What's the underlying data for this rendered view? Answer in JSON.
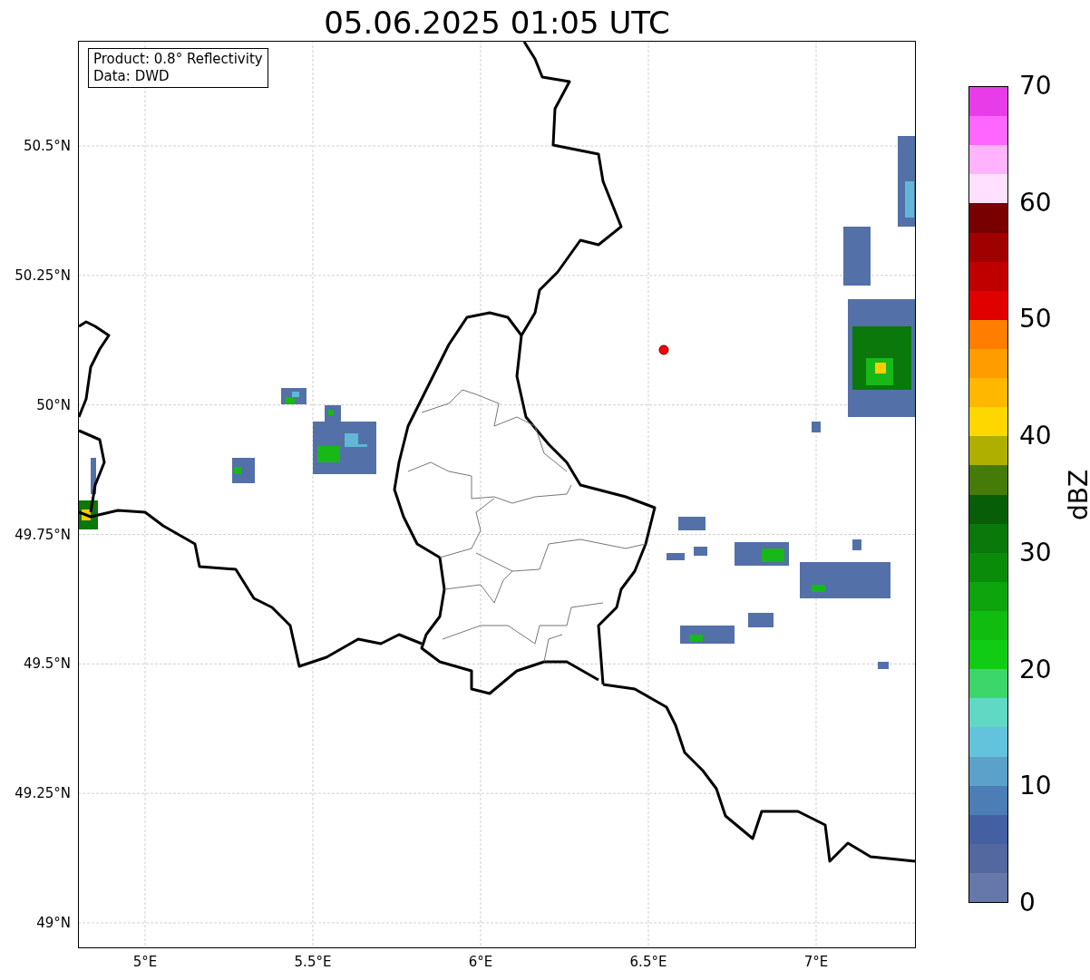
{
  "title": "05.06.2025 01:05 UTC",
  "legend": [
    "Product: 0.8° Reflectivity",
    "Data: DWD"
  ],
  "y_ticks": [
    "50.5°N",
    "50.25°N",
    "50°N",
    "49.75°N",
    "49.5°N",
    "49.25°N",
    "49°N"
  ],
  "x_ticks": [
    "5°E",
    "5.5°E",
    "6°E",
    "6.5°E",
    "7°E"
  ],
  "colorbar": {
    "label": "dBZ",
    "ticks": [
      "70",
      "60",
      "50",
      "40",
      "30",
      "20",
      "10",
      "0"
    ],
    "segments": [
      {
        "color": "#e93ce9"
      },
      {
        "color": "#ff66ff"
      },
      {
        "color": "#ffb3ff"
      },
      {
        "color": "#ffe0ff"
      },
      {
        "color": "#780000"
      },
      {
        "color": "#a00000"
      },
      {
        "color": "#c00000"
      },
      {
        "color": "#e00000"
      },
      {
        "color": "#ff7d00"
      },
      {
        "color": "#ff9c00"
      },
      {
        "color": "#ffb700"
      },
      {
        "color": "#ffd700"
      },
      {
        "color": "#afaf00"
      },
      {
        "color": "#467b0a"
      },
      {
        "color": "#085e08"
      },
      {
        "color": "#0a780a"
      },
      {
        "color": "#0a8c0a"
      },
      {
        "color": "#0ea40e"
      },
      {
        "color": "#10bc10"
      },
      {
        "color": "#10cc14"
      },
      {
        "color": "#3dd66b"
      },
      {
        "color": "#60d8c4"
      },
      {
        "color": "#64c3dc"
      },
      {
        "color": "#5ca1c9"
      },
      {
        "color": "#4c7db5"
      },
      {
        "color": "#4460a3"
      },
      {
        "color": "#5468a0"
      },
      {
        "color": "#6677aa"
      }
    ]
  }
}
